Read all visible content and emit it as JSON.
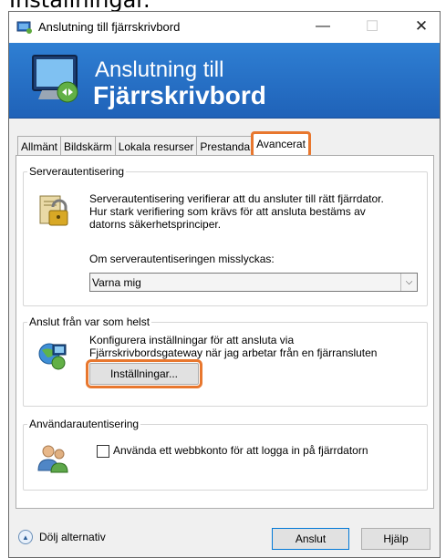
{
  "caption": "Inställningar.",
  "window": {
    "title": "Anslutning till fjärrskrivbord",
    "controls": {
      "minimize": "—",
      "maximize": "☐",
      "close": "✕"
    }
  },
  "banner": {
    "line1": "Anslutning till",
    "line2": "Fjärrskrivbord"
  },
  "tabs": [
    {
      "label": "Allmänt"
    },
    {
      "label": "Bildskärm"
    },
    {
      "label": "Lokala resurser"
    },
    {
      "label": "Prestanda"
    },
    {
      "label": "Avancerat",
      "active": true
    }
  ],
  "server_auth": {
    "legend": "Serverautentisering",
    "description_1": "Serverautentisering verifierar att du ansluter till rätt fjärrdator.",
    "description_2": "Hur stark verifiering som krävs för att ansluta bestäms av",
    "description_3": "datorns säkerhetsprinciper.",
    "fail_label": "Om serverautentiseringen misslyckas:",
    "fail_value": "Varna mig"
  },
  "connect_anywhere": {
    "legend": "Anslut från var som helst",
    "description_1": "Konfigurera inställningar för att ansluta via",
    "description_2": "Fjärrskrivbordsgateway när jag arbetar från en fjärransluten",
    "settings_button": "Inställningar..."
  },
  "user_auth": {
    "legend": "Användarautentisering",
    "checkbox_label": "Använda ett webbkonto för att logga in på fjärrdatorn",
    "checked": false
  },
  "footer": {
    "toggle_label": "Dölj alternativ",
    "connect_button": "Anslut",
    "help_button": "Hjälp"
  },
  "colors": {
    "accent": "#1f62b8",
    "highlight": "#e8772e"
  },
  "icons": [
    "rdp-app-icon",
    "monitor-icon",
    "lock-icon",
    "globe-network-icon",
    "users-icon",
    "collapse-icon"
  ]
}
